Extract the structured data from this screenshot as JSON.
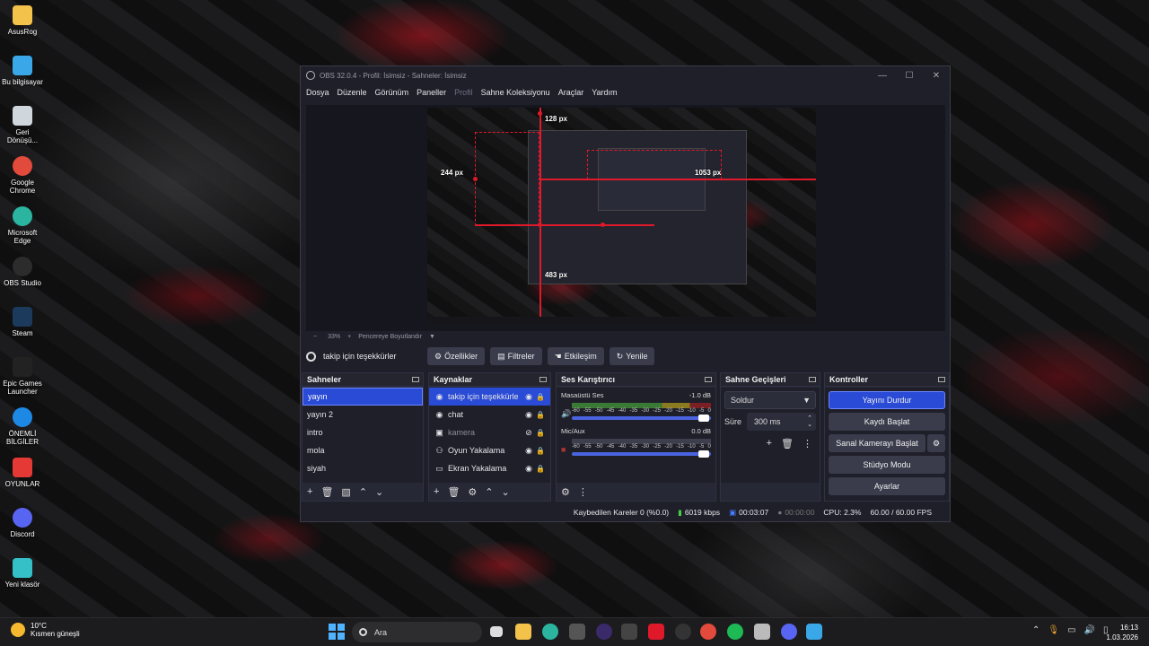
{
  "desktop": {
    "icons": [
      {
        "label": "AsusRog",
        "icon": "folder-icon",
        "color": "#f2c24a"
      },
      {
        "label": "Bu bilgisayar",
        "icon": "computer-icon",
        "color": "#3aa8e8"
      },
      {
        "label": "Geri Dönüşü...",
        "icon": "recycle-bin-icon",
        "color": "#cfd6dc"
      },
      {
        "label": "Google Chrome",
        "icon": "chrome-icon",
        "color": "#e24a3b"
      },
      {
        "label": "Microsoft Edge",
        "icon": "edge-icon",
        "color": "#2bb5a0"
      },
      {
        "label": "OBS Studio",
        "icon": "obs-icon",
        "color": "#2c2c2c"
      },
      {
        "label": "Steam",
        "icon": "steam-icon",
        "color": "#1b3a5c"
      },
      {
        "label": "Epic Games Launcher",
        "icon": "epic-icon",
        "color": "#222"
      },
      {
        "label": "ÖNEMLİ BİLGİLER",
        "icon": "help-icon",
        "color": "#1e88e5"
      },
      {
        "label": "OYUNLAR",
        "icon": "games-icon",
        "color": "#e53935"
      },
      {
        "label": "Discord",
        "icon": "discord-icon",
        "color": "#5865f2"
      },
      {
        "label": "Yeni klasör",
        "icon": "folder-icon",
        "color": "#35c0c8"
      }
    ]
  },
  "obs": {
    "title": "OBS 32.0.4 - Profil: İsimsiz - Sahneler: İsimsiz",
    "menu": [
      "Dosya",
      "Düzenle",
      "Görünüm",
      "Paneller",
      "Profil",
      "Sahne Koleksiyonu",
      "Araçlar",
      "Yardım"
    ],
    "preview": {
      "labels": {
        "top": "128 px",
        "left": "244 px",
        "right": "1053 px",
        "bottom": "483 px"
      }
    },
    "zoom": {
      "minus": "−",
      "value": "33%",
      "plus": "+",
      "fit": "Pencereye Boyutlandır"
    },
    "source_bar": {
      "selected": "takip için teşekkürler",
      "buttons": [
        "Özellikler",
        "Filtreler",
        "Etkileşim",
        "Yenile"
      ]
    },
    "scenes": {
      "title": "Sahneler",
      "items": [
        "yayın",
        "yayın 2",
        "intro",
        "mola",
        "siyah"
      ],
      "selected": 0
    },
    "sources": {
      "title": "Kaynaklar",
      "items": [
        {
          "label": "takip için teşekkürler",
          "icon": "browser-icon"
        },
        {
          "label": "chat",
          "icon": "browser-icon"
        },
        {
          "label": "kamera",
          "icon": "camera-icon"
        },
        {
          "label": "Oyun Yakalama",
          "icon": "gamepad-icon"
        },
        {
          "label": "Ekran Yakalama",
          "icon": "monitor-icon"
        }
      ]
    },
    "mixer": {
      "title": "Ses Karıştırıcı",
      "channels": [
        {
          "name": "Masaüstü Ses",
          "db": "-1.0 dB",
          "muted": false
        },
        {
          "name": "Mic/Aux",
          "db": "0.0 dB",
          "muted": true
        }
      ],
      "scale": [
        "-60",
        "-55",
        "-50",
        "-45",
        "-40",
        "-35",
        "-30",
        "-25",
        "-20",
        "-15",
        "-10",
        "-5",
        "0"
      ]
    },
    "transitions": {
      "title": "Sahne Geçişleri",
      "type": "Soldur",
      "duration_label": "Süre",
      "duration": "300 ms"
    },
    "controls": {
      "title": "Kontroller",
      "buttons": [
        "Yayını Durdur",
        "Kaydı Başlat",
        "Sanal Kamerayı Başlat",
        "Stüdyo Modu",
        "Ayarlar"
      ]
    },
    "status": {
      "dropped": "Kaybedilen Kareler 0 (%0.0)",
      "bitrate": "6019 kbps",
      "stream_time": "00:03:07",
      "rec_time": "00:00:00",
      "cpu": "CPU: 2.3%",
      "fps": "60.00 / 60.00 FPS"
    }
  },
  "taskbar": {
    "weather_temp": "10°C",
    "weather_desc": "Kısmen güneşli",
    "search_placeholder": "Ara",
    "time": "16:13",
    "date": "1.03.2026"
  }
}
